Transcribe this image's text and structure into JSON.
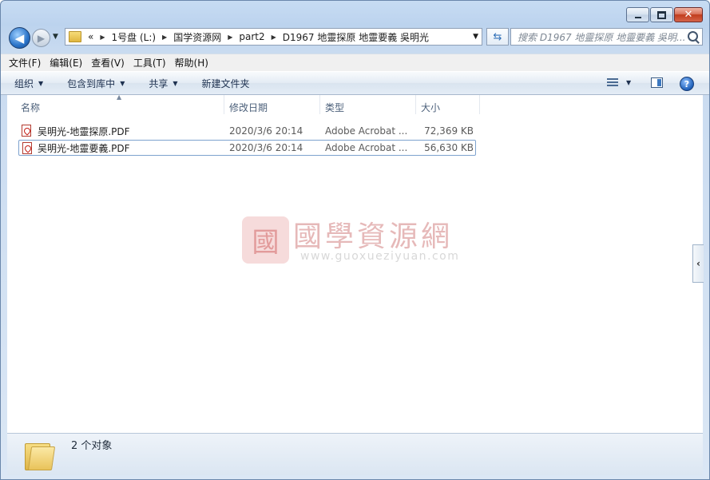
{
  "window": {
    "caption_buttons": {
      "minimize": "minimize",
      "maximize": "maximize",
      "close": "✕"
    }
  },
  "nav": {
    "back_glyph": "◀",
    "forward_glyph": "▶",
    "breadcrumb": {
      "overflow": "«",
      "items": [
        "1号盘 (L:)",
        "国学资源网",
        "part2",
        "D1967 地靈探原 地靈要義 吳明光"
      ]
    },
    "search_placeholder": "搜索 D1967 地靈探原 地靈要義 吳明..."
  },
  "menu": [
    "文件(F)",
    "编辑(E)",
    "查看(V)",
    "工具(T)",
    "帮助(H)"
  ],
  "toolbar": {
    "buttons": [
      "组织",
      "包含到库中",
      "共享",
      "新建文件夹"
    ],
    "help_label": "?"
  },
  "columns": {
    "name": "名称",
    "date": "修改日期",
    "type": "类型",
    "size": "大小"
  },
  "files": [
    {
      "name": "吴明光-地靈探原.PDF",
      "date": "2020/3/6 20:14",
      "type": "Adobe Acrobat ...",
      "size": "72,369 KB"
    },
    {
      "name": "吴明光-地靈要義.PDF",
      "date": "2020/3/6 20:14",
      "type": "Adobe Acrobat ...",
      "size": "56,630 KB"
    }
  ],
  "watermark": {
    "seal": "國",
    "title": "國學資源網",
    "url": "www.guoxueziyuan.com"
  },
  "status": {
    "count": "2 个对象"
  },
  "sidetab_glyph": "‹"
}
